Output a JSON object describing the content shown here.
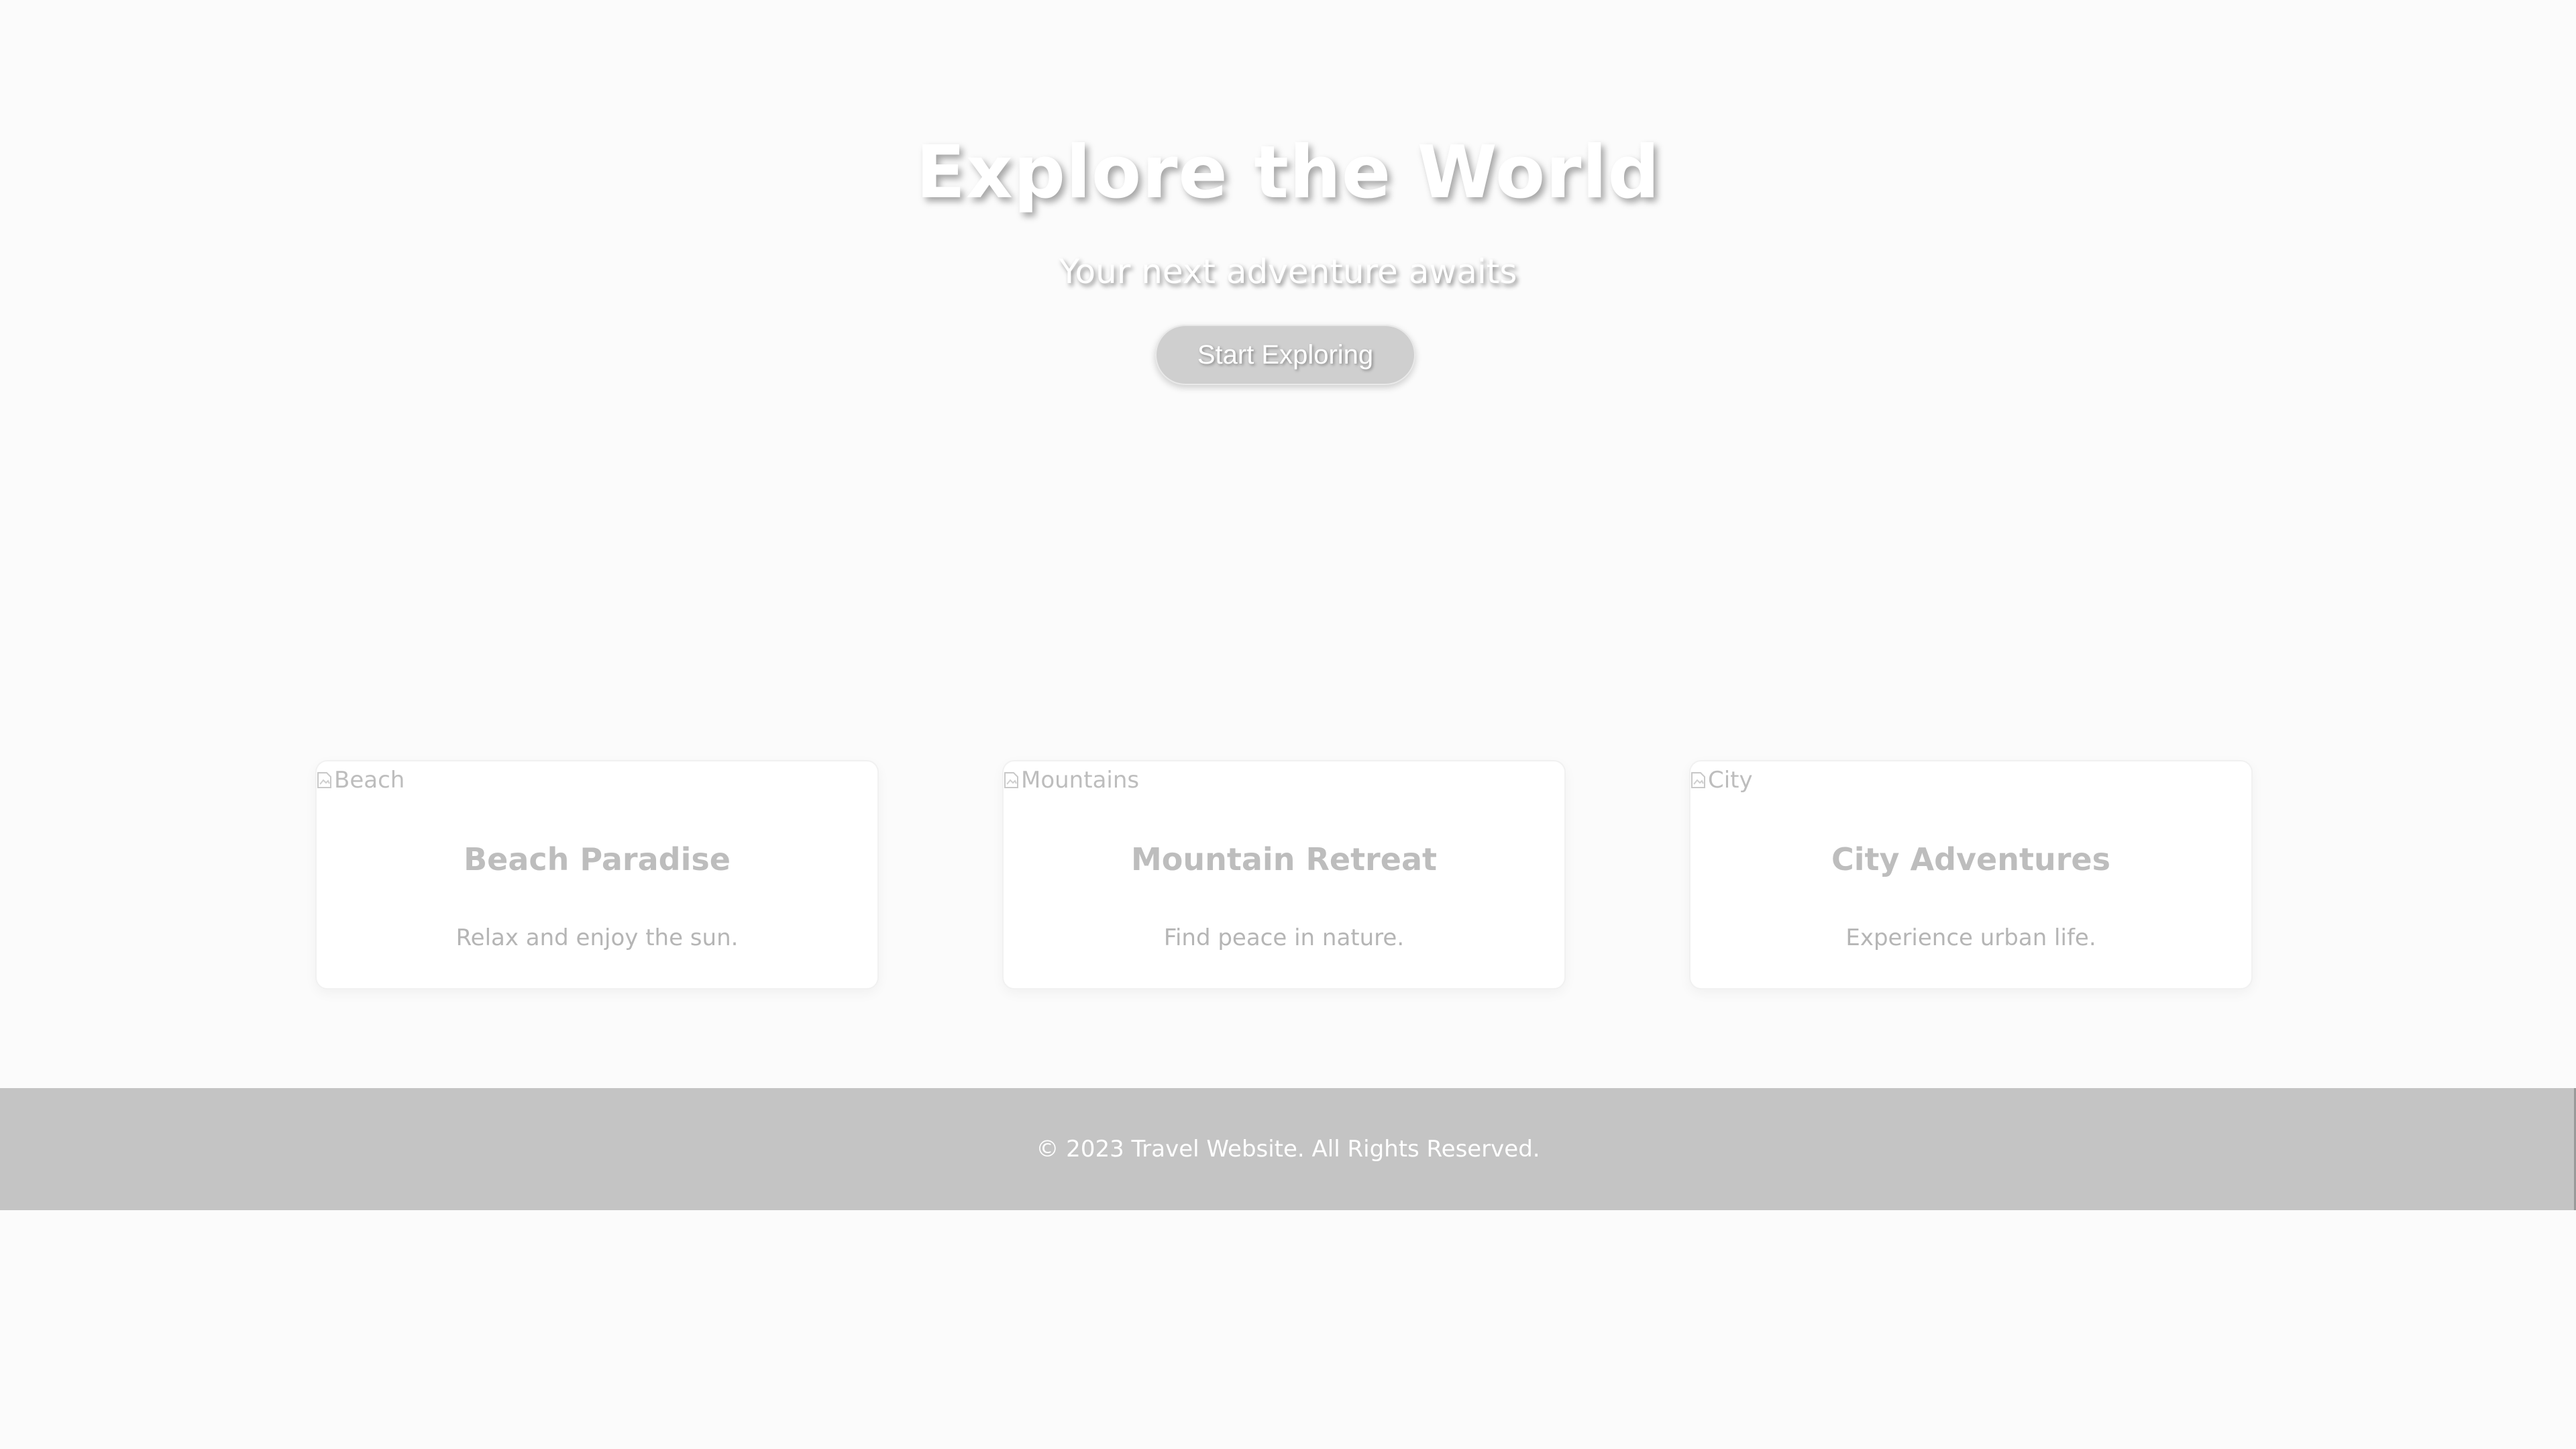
{
  "hero": {
    "title": "Explore the World",
    "subtitle": "Your next adventure awaits",
    "button_label": "Start Exploring"
  },
  "cards": [
    {
      "image_alt": "Beach",
      "title": "Beach Paradise",
      "description": "Relax and enjoy the sun."
    },
    {
      "image_alt": "Mountains",
      "title": "Mountain Retreat",
      "description": "Find peace in nature."
    },
    {
      "image_alt": "City",
      "title": "City Adventures",
      "description": "Experience urban life."
    }
  ],
  "footer": {
    "copyright": "© 2023 Travel Website. All Rights Reserved."
  },
  "colors": {
    "background": "#fbfbfb",
    "footer_background": "#c4c4c4",
    "card_text": "#bdbdbd",
    "button_background": "#cfcfcf"
  }
}
